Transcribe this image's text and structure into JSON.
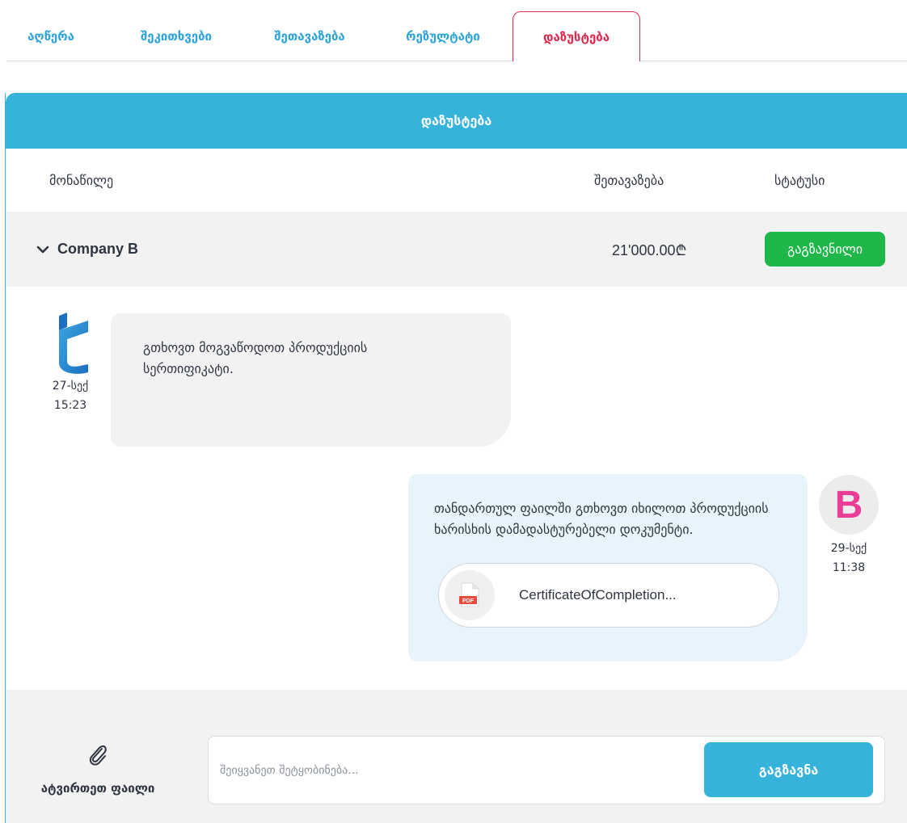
{
  "tabs": [
    {
      "label": "აღწერა",
      "active": false
    },
    {
      "label": "შეკითხვები",
      "active": false
    },
    {
      "label": "შეთავაზება",
      "active": false
    },
    {
      "label": "რეზულტატი",
      "active": false
    },
    {
      "label": "დაზუსტება",
      "active": true
    }
  ],
  "panel": {
    "title": "დაზუსტება",
    "columns": {
      "participant": "მონაწილე",
      "offer": "შეთავაზება",
      "status": "სტატუსი"
    }
  },
  "row": {
    "company": "Company B",
    "price": "21'000.00₾",
    "status": "გაგზავნილი",
    "status_color": "#1fb74a"
  },
  "messages": [
    {
      "side": "left",
      "avatar_icon": "tender-logo-icon",
      "date": "27-სექ",
      "time": "15:23",
      "text": "გთხოვთ მოგვაწოდოთ პროდუქციის სერთიფიკატი."
    },
    {
      "side": "right",
      "avatar_letter": "B",
      "date": "29-სექ",
      "time": "11:38",
      "text": "თანდართულ ფაილში გთხოვთ იხილოთ პროდუქციის ხარისხის დამადასტურებელი დოკუმენტი.",
      "attachment": {
        "name": "CertificateOfCompletion...",
        "type": "PDF",
        "icon": "pdf-file-icon"
      }
    }
  ],
  "composer": {
    "attach_label": "ატვირთეთ ფაილი",
    "attach_icon": "paperclip-icon",
    "placeholder": "შეიყვანეთ შეტყობინება...",
    "send_label": "გაგზავნა"
  },
  "colors": {
    "accent": "#36b3da",
    "active_tab": "#e0284b",
    "success": "#1fb74a",
    "avatar_b": "#ea3d95"
  }
}
